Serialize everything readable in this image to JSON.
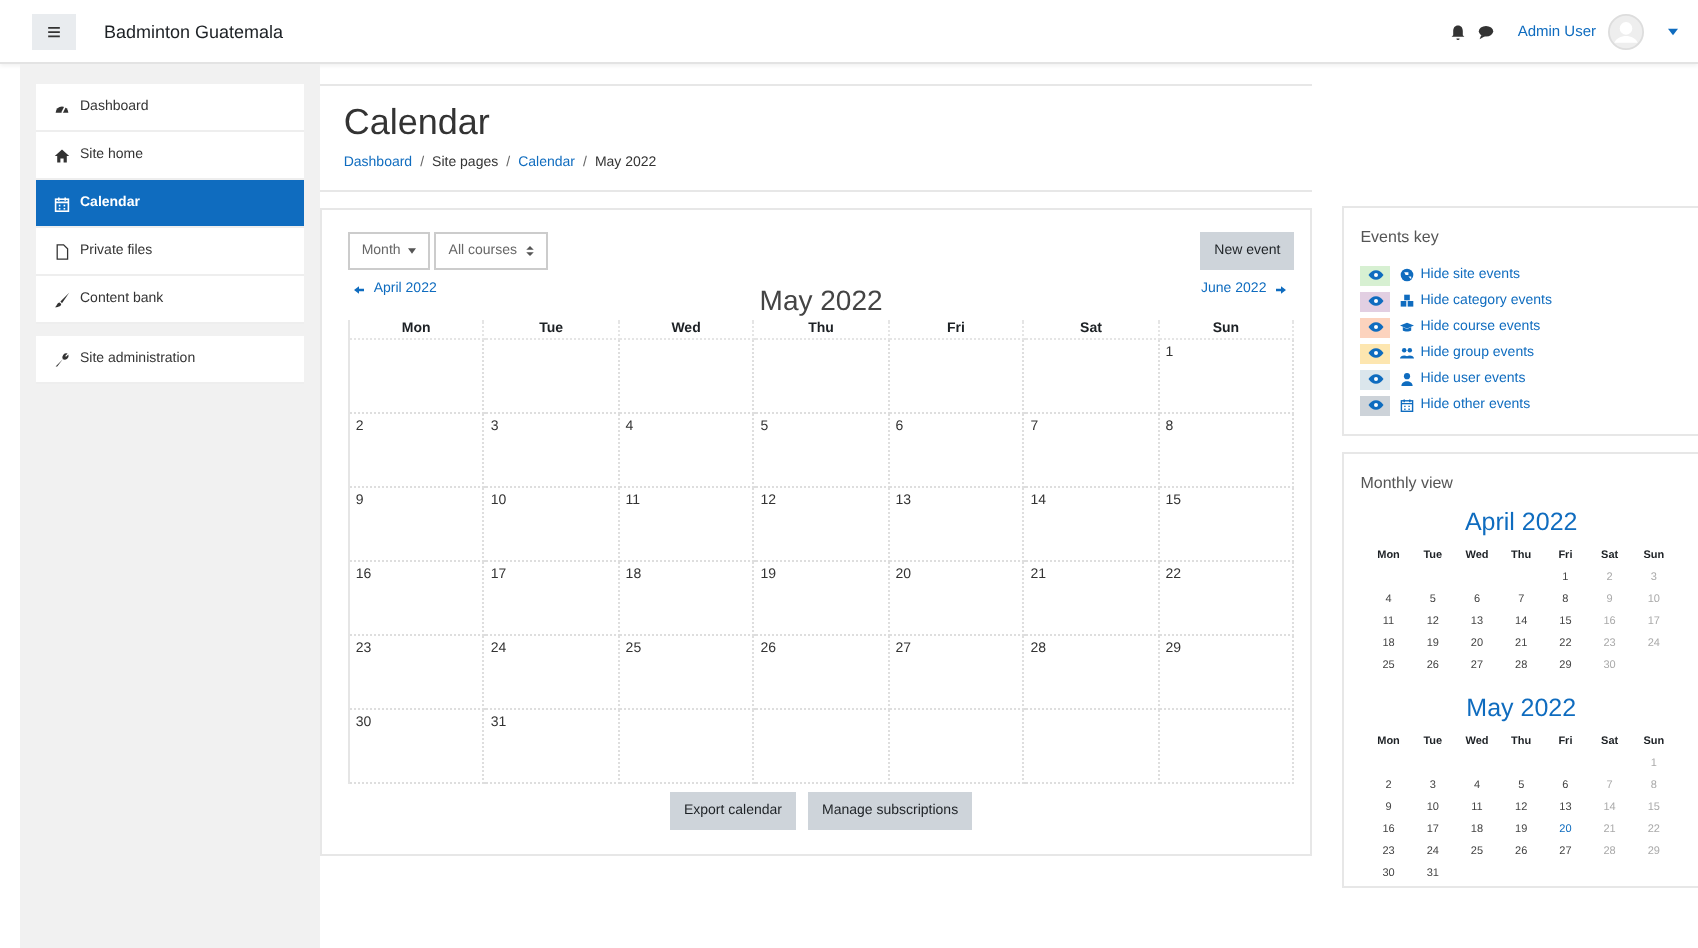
{
  "navbar": {
    "menu_icon": "≡",
    "site_name": "Badminton Guatemala",
    "user_name": "Admin User"
  },
  "sidebar": {
    "groups": [
      [
        {
          "label": "Dashboard",
          "selected": false
        },
        {
          "label": "Site home",
          "selected": false
        },
        {
          "label": "Calendar",
          "selected": true
        },
        {
          "label": "Private files",
          "selected": false
        },
        {
          "label": "Content bank",
          "selected": false
        }
      ],
      [
        {
          "label": "Site administration",
          "selected": false
        }
      ]
    ]
  },
  "page_header": {
    "title": "Calendar",
    "breadcrumb": [
      {
        "label": "Dashboard",
        "link": true
      },
      {
        "separator": "/",
        "label": "Site pages",
        "link": false
      },
      {
        "separator": "/",
        "label": "Calendar",
        "link": true
      },
      {
        "separator": "/",
        "label": "May 2022",
        "link": false
      }
    ]
  },
  "calendar": {
    "view_select": "Month",
    "course_select": "All courses",
    "new_event": "New event",
    "prev": "April 2022",
    "next": "June 2022",
    "month_title": "May 2022",
    "days": [
      "Mon",
      "Tue",
      "Wed",
      "Thu",
      "Fri",
      "Sat",
      "Sun"
    ],
    "weeks": [
      [
        "1"
      ],
      [
        "2",
        "3",
        "4",
        "5",
        "6",
        "7",
        "8"
      ],
      [
        "9",
        "10",
        "11",
        "12",
        "13",
        "14",
        "15"
      ],
      [
        "16",
        "17",
        "18",
        "19",
        "20",
        "21",
        "22"
      ],
      [
        "23",
        "24",
        "25",
        "26",
        "27",
        "28",
        "29"
      ],
      [
        "30",
        "31"
      ]
    ],
    "buttons": [
      "Export calendar",
      "Manage subscriptions"
    ]
  },
  "events_key": {
    "title": "Events key",
    "items": [
      {
        "label": "Hide site events",
        "color": "#d7f0d2"
      },
      {
        "label": "Hide category events",
        "color": "#e2cfe2"
      },
      {
        "label": "Hide course events",
        "color": "#fcd3be"
      },
      {
        "label": "Hide group events",
        "color": "#fde6b0"
      },
      {
        "label": "Hide user events",
        "color": "#dbe6ec"
      },
      {
        "label": "Hide other events",
        "color": "#cdd3d9"
      }
    ]
  },
  "monthly_view": {
    "title": "Monthly view",
    "months": [
      {
        "title": "April 2022",
        "days": [
          "Mon",
          "Tue",
          "Wed",
          "Thu",
          "Fri",
          "Sat",
          "Sun"
        ],
        "weeks": [
          [
            "1",
            "2",
            "3"
          ],
          [
            "4",
            "5",
            "6",
            "7",
            "8",
            "9",
            "10"
          ],
          [
            "11",
            "12",
            "13",
            "14",
            "15",
            "16",
            "17"
          ],
          [
            "18",
            "19",
            "20",
            "21",
            "22",
            "23",
            "24"
          ],
          [
            "25",
            "26",
            "27",
            "28",
            "29",
            "30"
          ]
        ]
      },
      {
        "title": "May 2022",
        "days": [
          "Mon",
          "Tue",
          "Wed",
          "Thu",
          "Fri",
          "Sat",
          "Sun"
        ],
        "weeks": [
          [
            "1"
          ],
          [
            "2",
            "3",
            "4",
            "5",
            "6",
            "7",
            "8"
          ],
          [
            "9",
            "10",
            "11",
            "12",
            "13",
            "14",
            "15"
          ],
          [
            "16",
            "17",
            "18",
            "19",
            {
              "day": "20",
              "today": true
            },
            "21",
            "22"
          ],
          [
            "23",
            "24",
            "25",
            "26",
            "27",
            "28",
            "29"
          ],
          [
            "30",
            "31"
          ]
        ]
      }
    ]
  }
}
